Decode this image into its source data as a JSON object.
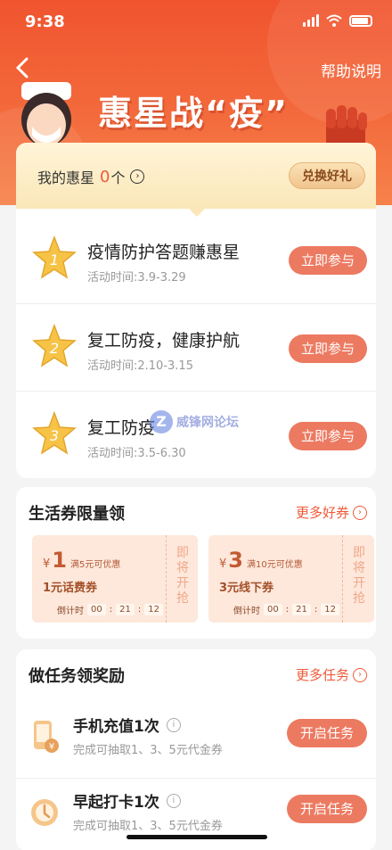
{
  "status_bar": {
    "time": "9:38"
  },
  "header": {
    "back_icon": "chevron-left-icon",
    "help_label": "帮助说明",
    "title": "惠星战“疫”"
  },
  "stars": {
    "label": "我的惠星",
    "count": "0",
    "unit": "个",
    "redeem_label": "兑换好礼",
    "items": [
      {
        "badge": "1",
        "title": "疫情防护答题赚惠星",
        "time": "活动时间:3.9-3.29",
        "button": "立即参与"
      },
      {
        "badge": "2",
        "title": "复工防疫，健康护航",
        "time": "活动时间:2.10-3.15",
        "button": "立即参与"
      },
      {
        "badge": "3",
        "title": "复工防疫",
        "time": "活动时间:3.5-6.30",
        "button": "立即参与"
      }
    ]
  },
  "watermark": {
    "text": "威锋网论坛"
  },
  "coupons": {
    "title": "生活券限量领",
    "more_label": "更多好券",
    "items": [
      {
        "yen": "¥",
        "amount": "1",
        "condition": "满5元可优惠",
        "name": "1元话费券",
        "countdown_label": "倒计时",
        "hh": "00",
        "mm": "21",
        "ss": "12",
        "side": "即将开抢"
      },
      {
        "yen": "¥",
        "amount": "3",
        "condition": "满10元可优惠",
        "name": "3元线下券",
        "countdown_label": "倒计时",
        "hh": "00",
        "mm": "21",
        "ss": "12",
        "side": "即将开抢"
      }
    ]
  },
  "tasks": {
    "title": "做任务领奖励",
    "more_label": "更多任务",
    "items": [
      {
        "title": "手机充值1次",
        "sub": "完成可抽取1、3、5元代金券",
        "button": "开启任务"
      },
      {
        "title": "早起打卡1次",
        "sub": "完成可抽取1、3、5元代金券",
        "button": "开启任务"
      }
    ]
  },
  "colors": {
    "brand_red": "#f0542e",
    "accent_orange": "#ec7a61",
    "gold": "#fbe7b8"
  }
}
